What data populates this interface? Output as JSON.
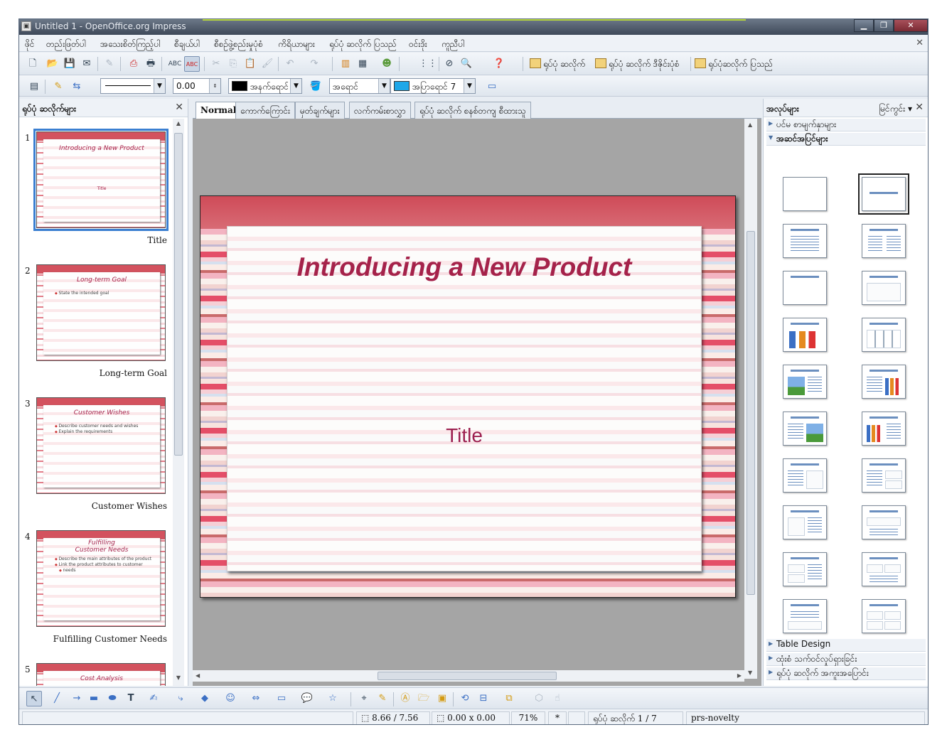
{
  "window": {
    "title": "Untitled 1 - OpenOffice.org Impress"
  },
  "menu": [
    "ဖိုင်",
    "တည်းဖြတ်ပါ",
    "အသေးစိတ်ကြည့်ပါ",
    "စီချယ်ပါ",
    "စီစဉ်ဖွဲ့စည်းမှုပုံစံ",
    "ကိရိယာများ",
    "ရုပ်ပုံ ဆလိုက် ပြသည်",
    "ဝင်းဒိုး",
    "ကူညီပါ"
  ],
  "toolbar1": {
    "slide_btn": "ရုပ်ပုံ ဆလိုက်",
    "slide_design_btn": "ရုပ်ပုံ ဆလိုက် ဒီဇိုင်းပုံစံ",
    "slideshow_btn": "ရုပ်ပုံဆလိုက် ပြသည်"
  },
  "toolbar2": {
    "line_width": "0.00",
    "line_color": "အနက်ရောင်",
    "line_color_hex": "#000000",
    "area_style": "အရောင်",
    "area_color": "အပြာရောင် 7",
    "area_color_hex": "#1ea7e8"
  },
  "slides_pane": {
    "title": "ရုပ်ပုံ ဆလိုက်များ",
    "slides": [
      {
        "num": "1",
        "name": "Title",
        "title": "Introducing a New Product",
        "subtitle": "Title",
        "bullets": []
      },
      {
        "num": "2",
        "name": "Long-term Goal",
        "title": "Long-term Goal",
        "subtitle": "",
        "bullets": [
          "State the intended goal"
        ]
      },
      {
        "num": "3",
        "name": "Customer Wishes",
        "title": "Customer Wishes",
        "subtitle": "",
        "bullets": [
          "Describe customer needs and wishes",
          "Explain the requirements"
        ]
      },
      {
        "num": "4",
        "name": "Fulfilling Customer Needs",
        "title": "Fulfilling\nCustomer Needs",
        "subtitle": "",
        "bullets": [
          "Describe the main attributes of the product",
          "Link the product attributes to customer",
          "needs"
        ]
      },
      {
        "num": "5",
        "name": "",
        "title": "Cost Analysis",
        "subtitle": "",
        "bullets": []
      }
    ]
  },
  "tabs": [
    "Normal",
    "ကောက်ကြောင်း",
    "မှတ်ချက်များ",
    "လက်ကမ်းစာလွှာ",
    "ရုပ်ပုံ ဆလိုက် စနစ်တကျ စီထားသူ"
  ],
  "slide": {
    "title": "Introducing a New Product",
    "subtitle": "Title"
  },
  "tasks_pane": {
    "title": "အလုပ်များ",
    "view_menu": "မြင်ကွင်း",
    "sections": {
      "master_pages": "ပင်မ စာမျက်နှာများ",
      "layouts": "အဆင်အပြင်များ",
      "table_design": "Table Design",
      "custom_animation": "ထုံးစံ သက်ဝင်လှုပ်ရှားခြင်း",
      "slide_transition": "ရုပ်ပုံ ဆလိုက် အကူးအပြောင်း"
    }
  },
  "status": {
    "position": "8.66 / 7.56",
    "size": "0.00 x 0.00",
    "zoom": "71%",
    "modified": "*",
    "slide": "ရုပ်ပုံ ဆလိုက် 1 / 7",
    "design": "prs-novelty"
  }
}
